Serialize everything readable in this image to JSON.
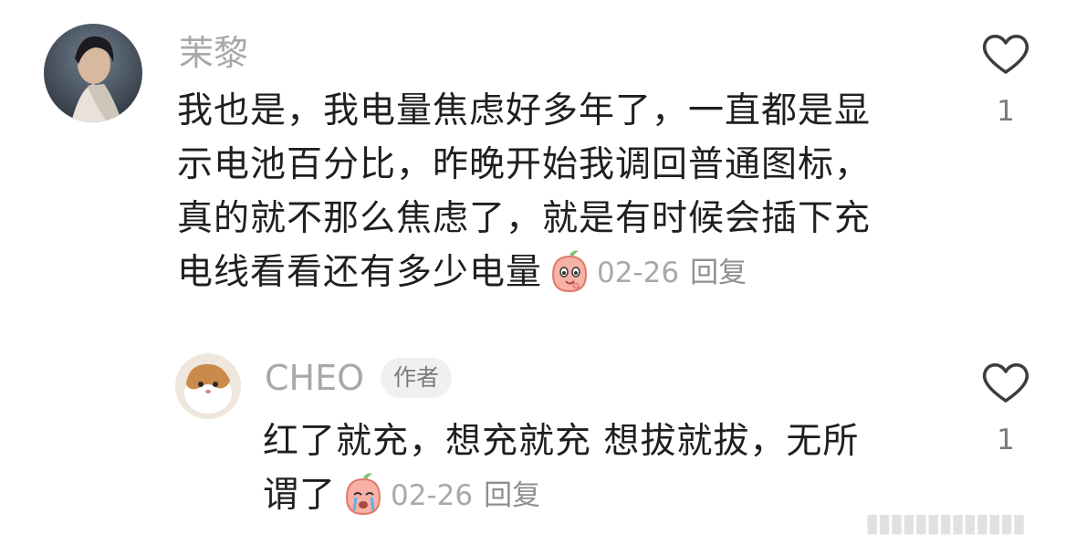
{
  "comments": [
    {
      "username": "茉黎",
      "text_lines": [
        "我也是，我电量焦虑好多年了，一直都是显",
        "示电池百分比，昨晚开始我调回普通图标，",
        "真的就不那么焦虑了，就是有时候会插下充",
        "电线看看还有多少电量"
      ],
      "emoji": "peach-emoji",
      "date": "02-26",
      "reply_label": "回复",
      "like_count": "1",
      "like_icon": "heart-outline-icon"
    }
  ],
  "reply": {
    "username": "CHEO",
    "author_badge": "作者",
    "text_lines": [
      "红了就充，想充就充 想拔就拔，无所",
      "谓了"
    ],
    "emoji": "peach-crying-emoji",
    "date": "02-26",
    "reply_label": "回复",
    "like_count": "1",
    "like_icon": "heart-outline-icon"
  },
  "watermark": "▮▮▮▮▮▮▮▮▮▮▮▮▮",
  "colors": {
    "username": "#a8a8a8",
    "text": "#1f1f1f",
    "meta": "#a9a9a9",
    "badge_bg": "#f0f0f0",
    "heart": "#3d3d3d",
    "peach": "#f4a79d"
  }
}
